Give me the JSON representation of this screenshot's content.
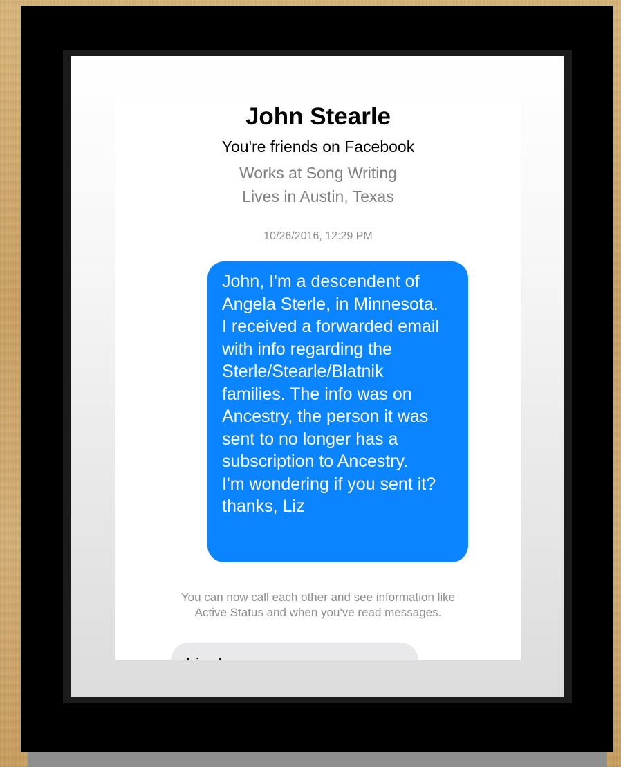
{
  "conversation": {
    "contact_name": "John Stearle",
    "friend_status": "You're friends on Facebook",
    "work": "Works at Song Writing",
    "location": "Lives in Austin, Texas",
    "timestamp": "10/26/2016, 12:29 PM",
    "messages": [
      {
        "direction": "outgoing",
        "text": "John, I'm a descendent of\nAngela Sterle, in Minnesota.\nI received a forwarded email\nwith info regarding the\nSterle/Stearle/Blatnik\nfamilies.  The info was on\nAncestry, the person it was\nsent to no longer has a\nsubscription to Ancestry.\nI'm wondering if you sent it?\nthanks, Liz"
      }
    ],
    "system_notice": "You can now call each other and see information like\nActive Status and when you've read messages.",
    "incoming_preview": "Liz, I am so sorry, sorry"
  },
  "colors": {
    "outgoing_bubble": "#0a84ff",
    "incoming_bubble": "#e9e9eb",
    "secondary_text": "#8e8e8e",
    "frame": "#000000"
  }
}
